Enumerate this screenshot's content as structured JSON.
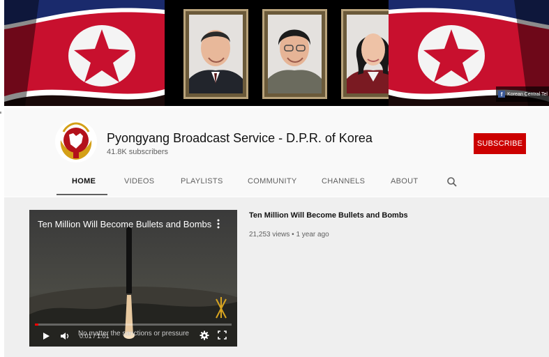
{
  "banner": {
    "watermark_text": "Korean Central Tel",
    "watermark_icon": "facebook-icon",
    "colors": {
      "flag_red": "#c8102e",
      "flag_white": "#ffffff",
      "flag_blue": "#1a2a6c",
      "star_red": "#c8102e"
    }
  },
  "channel": {
    "name": "Pyongyang Broadcast Service - D.P.R. of Korea",
    "subscribers": "41.8K subscribers",
    "subscribe_label": "SUBSCRIBE",
    "colors": {
      "subscribe_bg": "#cc0000",
      "avatar_red": "#b3121b",
      "avatar_gold": "#d4a017"
    }
  },
  "tabs": [
    {
      "label": "HOME",
      "active": true
    },
    {
      "label": "VIDEOS",
      "active": false
    },
    {
      "label": "PLAYLISTS",
      "active": false
    },
    {
      "label": "COMMUNITY",
      "active": false
    },
    {
      "label": "CHANNELS",
      "active": false
    },
    {
      "label": "ABOUT",
      "active": false
    }
  ],
  "search_icon": "search-icon",
  "featured_video": {
    "title": "Ten Million Will Become Bullets and Bombs",
    "overlay_title": "Ten Million Will Become Bullets and Bombs",
    "caption": "No matter the sanctions or pressure",
    "timecode": "0:01 / 1:01",
    "progress": 0.016,
    "views": "21,253 views",
    "age": "1 year ago",
    "meta_separator": "•",
    "icons": [
      "play-icon",
      "volume-icon",
      "settings-icon",
      "fullscreen-icon",
      "more-vert-icon",
      "party-emblem-icon"
    ]
  }
}
